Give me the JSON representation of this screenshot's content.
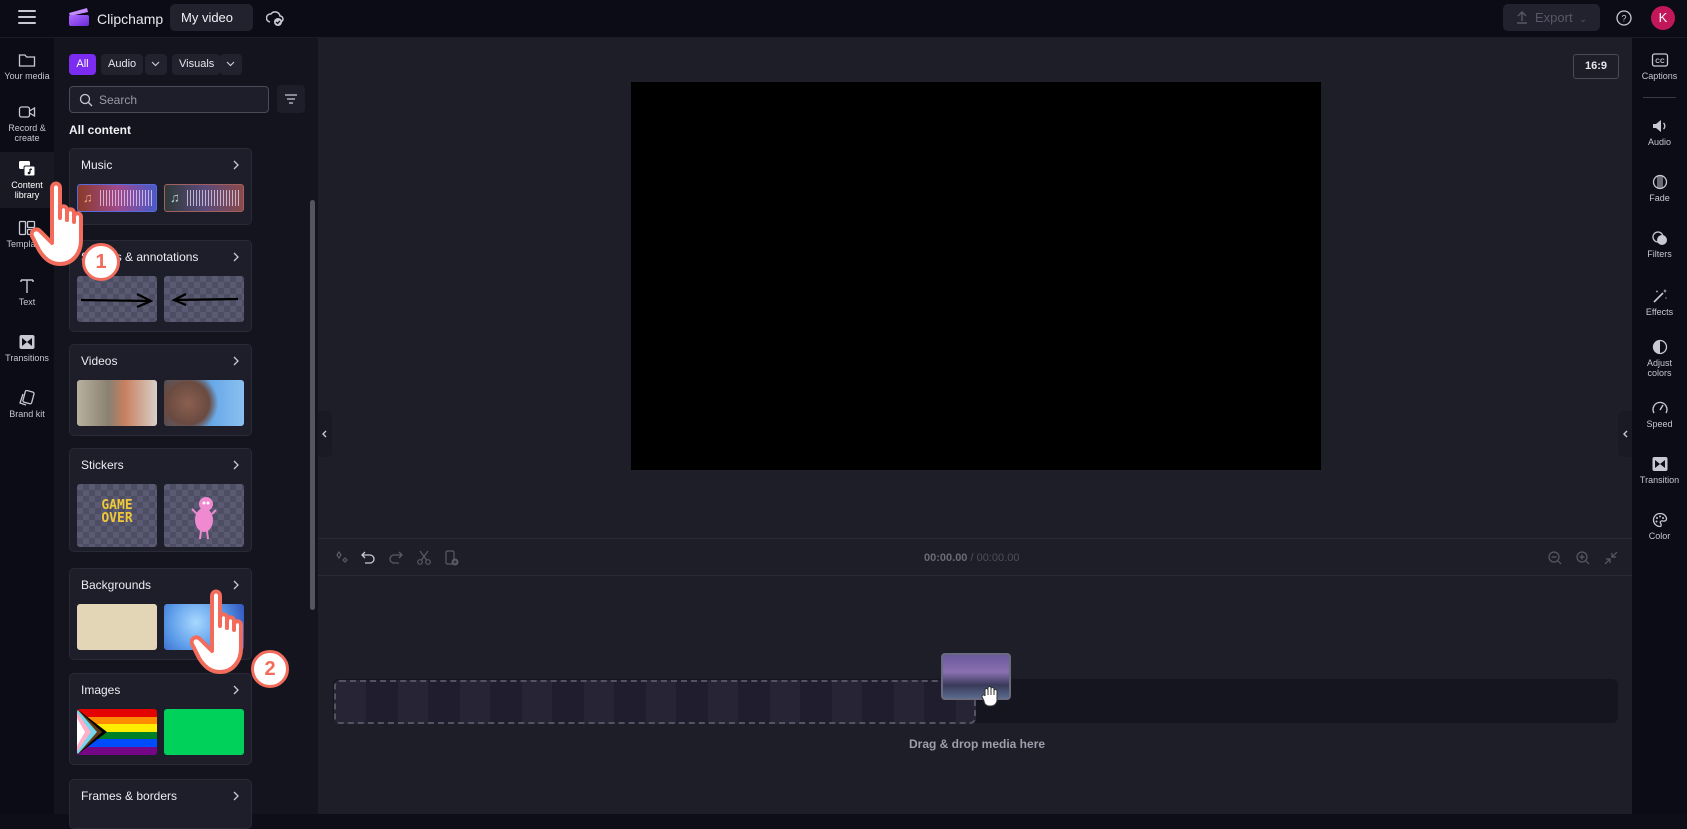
{
  "topbar": {
    "app_name": "Clipchamp",
    "project_title": "My video",
    "export_label": "Export",
    "avatar_initial": "K",
    "brand_color": "#7c2cf0",
    "avatar_color": "#c2185b"
  },
  "left_nav": {
    "items": [
      {
        "label": "Your media",
        "icon": "folder-icon"
      },
      {
        "label": "Record & create",
        "icon": "video-camera-icon"
      },
      {
        "label": "Content library",
        "icon": "content-library-icon",
        "active": true
      },
      {
        "label": "Templates",
        "icon": "templates-icon"
      },
      {
        "label": "Text",
        "icon": "text-icon"
      },
      {
        "label": "Transitions",
        "icon": "transitions-icon"
      },
      {
        "label": "Brand kit",
        "icon": "brand-kit-icon"
      }
    ]
  },
  "panel": {
    "filters": {
      "all": "All",
      "audio": "Audio",
      "visuals": "Visuals"
    },
    "search_placeholder": "Search",
    "section_title": "All content",
    "categories": [
      {
        "title": "Music"
      },
      {
        "title": "Shapes & annotations"
      },
      {
        "title": "Videos"
      },
      {
        "title": "Stickers",
        "sticker_text": "GAME OVER"
      },
      {
        "title": "Backgrounds"
      },
      {
        "title": "Images"
      },
      {
        "title": "Frames & borders"
      }
    ]
  },
  "preview": {
    "aspect_ratio": "16:9"
  },
  "timeline": {
    "current_time": "00:00.00",
    "total_time": "/ 00:00.00",
    "drop_hint": "Drag & drop media here"
  },
  "right_nav": {
    "items": [
      {
        "label": "Captions",
        "icon": "captions-icon"
      },
      {
        "label": "Audio",
        "icon": "speaker-icon"
      },
      {
        "label": "Fade",
        "icon": "fade-icon"
      },
      {
        "label": "Filters",
        "icon": "filters-icon"
      },
      {
        "label": "Effects",
        "icon": "magic-wand-icon"
      },
      {
        "label": "Adjust colors",
        "icon": "contrast-icon"
      },
      {
        "label": "Speed",
        "icon": "speedometer-icon"
      },
      {
        "label": "Transition",
        "icon": "transition-icon"
      },
      {
        "label": "Color",
        "icon": "palette-icon"
      }
    ]
  },
  "annotations": {
    "step1": "1",
    "step2": "2"
  }
}
